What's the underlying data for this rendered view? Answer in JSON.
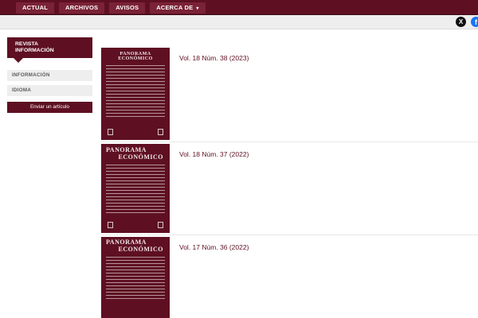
{
  "nav": {
    "items": [
      "ACTUAL",
      "ARCHIVOS",
      "AVISOS",
      "ACERCA DE"
    ],
    "dropdown_caret": "▾"
  },
  "sidebar": {
    "header_line1": "REVISTA",
    "header_line2": "INFORMACIÓN",
    "links": [
      "INFORMACIÓN",
      "IDIOMA"
    ],
    "submit_label": "Enviar un artículo"
  },
  "social": {
    "x_icon": "X",
    "facebook_icon": "f"
  },
  "issues": [
    {
      "title": "Vol. 18 Núm. 38 (2023)",
      "cover_line1": "PANORAMA",
      "cover_line2": "ECONÓMICO"
    },
    {
      "title": "Vol. 18 Núm. 37 (2022)",
      "cover_line1": "PANORAMA",
      "cover_line2": "ECONÓMICO"
    },
    {
      "title": "Vol. 17 Núm. 36 (2022)",
      "cover_line1": "PANORAMA",
      "cover_line2": "ECONÓMICO"
    }
  ],
  "colors": {
    "brand": "#5e1022",
    "nav_item": "#7a2236",
    "sidebar_link_bg": "#eeeeee"
  }
}
